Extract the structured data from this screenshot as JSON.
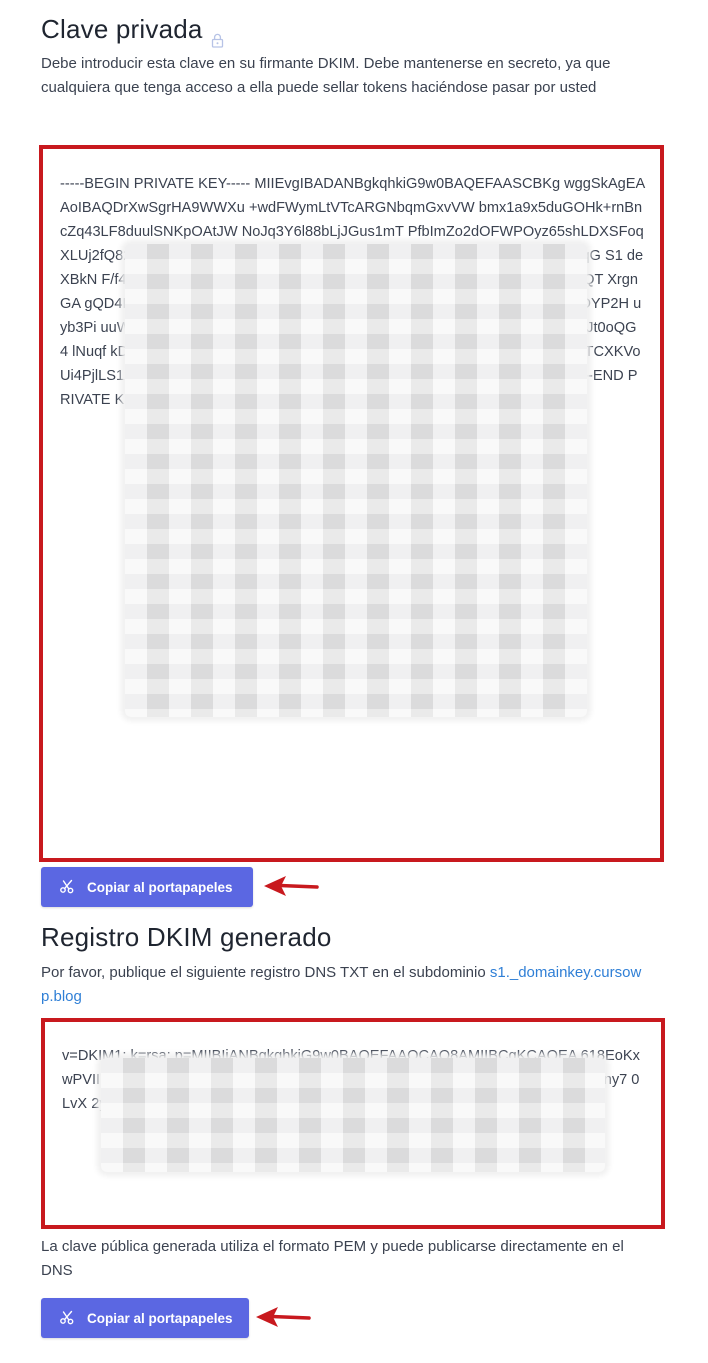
{
  "private_key_section": {
    "title": "Clave privada",
    "lock_icon": "lock-icon",
    "description": "Debe introducir esta clave en su firmante DKIM. Debe mantenerse en secreto, ya que cualquiera que tenga acceso a ella puede sellar tokens haciéndose pasar por usted",
    "key_text": "-----BEGIN PRIVATE KEY----- MIIEvgIBADANBgkqhkiG9w0BAQEFAASCBKg wggSkAgEAAoIBAQDrXwSgrHA9WWXu +wdFWymLtVTcARGNbqmGxvVW bmx1a9x5duGOHk+rnBncZq43LF8duulSNKpOAtJW NoJq3Y6l88bLjJGus1mT PfbImZo2dOFWPOyz65shLDXSFoqXLUj2fQ822FtEPEPM qSk2IlZugrQwn+dP YjCd7pV 2/LCCLU mpmcX PaAgup 7qG S1 deXBkN F/f4jcN QiY RdQ 7qF5hT dKIL dIC P0LDK 6E7Ykrk 80D7L MevyAQ HNJUQT XrgnGA gQD4K 7rKsk8r 7W71A Lzd/hrE MvZ5B6 gHgZPa y+qMQ odxoqe b24qSp UDYP2H uyb3Pi uuWI/rB Rwf5zz 8YL9E2z 2Rq1R olV8GgF O1fvjb YZag1o rl7odb X/T3KM Jt0oQG 4 lNuqf kD/78g psZ Fdu PBsKu YytBOTfs 63vWYFildVd X2b1XiCb3EhB02ZkyEeTCXKVoUi4PjlLS1zpu3RG/uTjrFqLNayz 660vKRwZRl3o Avug7JOq8nXpTibu19yl82En -----END PRIVATE KEY-----",
    "copy_button_label": "Copiar al portapapeles"
  },
  "dkim_record_section": {
    "title": "Registro DKIM generado",
    "description_prefix": "Por favor, publique el siguiente registro DNS TXT en el subdominio ",
    "subdomain_link": "s1._domainkey.cursowp.blog",
    "record_text": "v=DKIM1; k=rsa; p=MIIBIjANBgkqhkiG9w0BAQEFAAOCAQ8AMIIBCgKCAQEA 618EoKxwPVII7zsHBVspi7VU3AEBiW6phsh1Vm5sdWyceXbhih5Pa5w73Ga uNyx 10h aKly ny7 0LvX 2ym EHk ZkT mCW4xy0wvwwhYTQMTbQ29B/O6hktXXlwZDQIDAQAB",
    "footer_note": "La clave pública generada utiliza el formato PEM y puede publicarse directamente en el DNS",
    "copy_button_label": "Copiar al portapapeles"
  },
  "colors": {
    "button": "#5b67e2",
    "highlight_border": "#c8191e",
    "arrow": "#c8191e",
    "link": "#2f7fd6"
  }
}
